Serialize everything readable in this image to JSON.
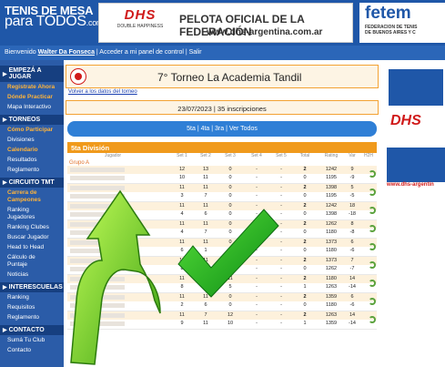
{
  "header": {
    "logo_line1": "TENIS DE MESA",
    "logo_line2": "para TODOS",
    "logo_dom": ".com",
    "banner_logo": "DHS",
    "banner_logo_sub": "DOUBLE HAPPINESS",
    "banner_title": "PELOTA OFICIAL DE LA FEDERACIÓN",
    "banner_url": "www.dhs-argentina.com.ar",
    "fete_title": "fetem",
    "fete_sub1": "FEDERACION DE TENIS",
    "fete_sub2": "DE BUENOS AIRES Y C"
  },
  "userbar": {
    "greeting": "Bienvenido",
    "user": "Walter Da Fonseca",
    "rest": "| Acceder a mi panel de control | Salir"
  },
  "sidebar": [
    {
      "title": "EMPEZÁ A JUGAR",
      "items": [
        {
          "label": "Registrate Ahora",
          "hl": true
        },
        {
          "label": "Dónde Practicar",
          "hl": true
        },
        {
          "label": "Mapa Interactivo",
          "hl": false
        }
      ]
    },
    {
      "title": "TORNEOS",
      "items": [
        {
          "label": "Cómo Participar",
          "hl": true
        },
        {
          "label": "Divisiones",
          "hl": false
        },
        {
          "label": "Calendario",
          "hl": true
        },
        {
          "label": "Resultados",
          "hl": false
        },
        {
          "label": "Reglamento",
          "hl": false
        }
      ]
    },
    {
      "title": "CIRCUITO TMT",
      "items": [
        {
          "label": "Carrera de Campeones",
          "hl": true
        },
        {
          "label": "Ranking Jugadores",
          "hl": false
        },
        {
          "label": "Ranking Clubes",
          "hl": false
        },
        {
          "label": "Buscar Jugador",
          "hl": false
        },
        {
          "label": "Head to Head",
          "hl": false
        },
        {
          "label": "Cálculo de Puntaje",
          "hl": false
        },
        {
          "label": "Noticias",
          "hl": false
        }
      ]
    },
    {
      "title": "INTERESCUELAS",
      "items": [
        {
          "label": "Ranking",
          "hl": false
        },
        {
          "label": "Requisitos",
          "hl": false
        },
        {
          "label": "Reglamento",
          "hl": false
        }
      ]
    },
    {
      "title": "CONTACTO",
      "items": [
        {
          "label": "Sumá Tu Club",
          "hl": false
        },
        {
          "label": "Contacto",
          "hl": false
        }
      ]
    }
  ],
  "main": {
    "title": "7° Torneo La Academia Tandil",
    "back": "Volver a los datos del torneo",
    "date_text": "23/07/2023 | 35 inscripciones",
    "sets_nav": "5ta | 4ta | 3ra | Ver Todos",
    "division": "5ta División",
    "group": "Grupo A"
  },
  "columns": {
    "player": "Jugador",
    "s1": "Set 1",
    "s2": "Set 2",
    "s3": "Set 3",
    "s4": "Set 4",
    "s5": "Set 5",
    "total": "Total",
    "rating": "Rating",
    "var": "Var",
    "hth": "H2H"
  },
  "matches": [
    {
      "top": [
        "12",
        "13",
        "0",
        "-",
        "-",
        "2",
        "1242",
        "9"
      ],
      "bot": [
        "10",
        "11",
        "0",
        "-",
        "-",
        "0",
        "1195",
        "-9"
      ]
    },
    {
      "top": [
        "11",
        "11",
        "0",
        "-",
        "-",
        "2",
        "1398",
        "5"
      ],
      "bot": [
        "3",
        "7",
        "0",
        "-",
        "-",
        "0",
        "1195",
        "-5"
      ]
    },
    {
      "top": [
        "11",
        "11",
        "0",
        "-",
        "-",
        "2",
        "1242",
        "18"
      ],
      "bot": [
        "4",
        "6",
        "0",
        "-",
        "-",
        "0",
        "1398",
        "-18"
      ]
    },
    {
      "top": [
        "11",
        "11",
        "0",
        "-",
        "-",
        "2",
        "1262",
        "8"
      ],
      "bot": [
        "4",
        "7",
        "0",
        "-",
        "-",
        "0",
        "1180",
        "-8"
      ]
    },
    {
      "top": [
        "11",
        "11",
        "0",
        "-",
        "-",
        "2",
        "1373",
        "6"
      ],
      "bot": [
        "6",
        "1",
        "0",
        "-",
        "-",
        "0",
        "1180",
        "-6"
      ]
    },
    {
      "top": [
        "11",
        "11",
        "0",
        "-",
        "-",
        "2",
        "1373",
        "7"
      ],
      "bot": [
        "8",
        "7",
        "0",
        "-",
        "-",
        "0",
        "1262",
        "-7"
      ]
    },
    {
      "top": [
        "11",
        "13",
        "11",
        "-",
        "-",
        "2",
        "1180",
        "14"
      ],
      "bot": [
        "8",
        "15",
        "5",
        "-",
        "-",
        "1",
        "1263",
        "-14"
      ]
    },
    {
      "top": [
        "11",
        "11",
        "0",
        "-",
        "-",
        "2",
        "1359",
        "6"
      ],
      "bot": [
        "2",
        "6",
        "0",
        "-",
        "-",
        "0",
        "1180",
        "-6"
      ]
    },
    {
      "top": [
        "11",
        "7",
        "12",
        "-",
        "-",
        "2",
        "1263",
        "14"
      ],
      "bot": [
        "9",
        "11",
        "10",
        "-",
        "-",
        "1",
        "1359",
        "-14"
      ]
    }
  ],
  "ad": {
    "logo": "DHS",
    "url": "www.dhs-argentin"
  },
  "colors": {
    "header_blue": "#1f57a8",
    "orange": "#f09a1c",
    "arrow_green": "#7bd420",
    "check_green": "#17b31a"
  }
}
